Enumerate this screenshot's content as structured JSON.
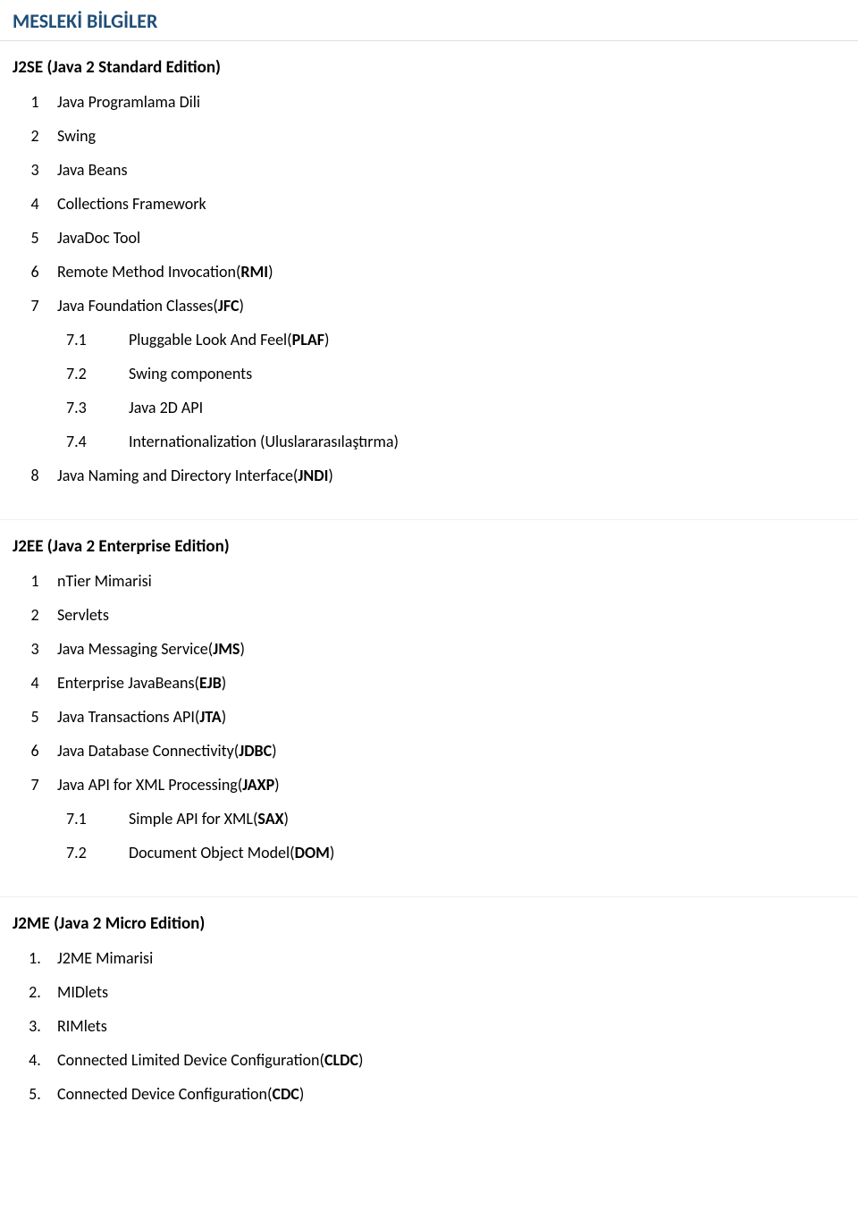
{
  "pageTitle": "MESLEKİ BİLGİLER",
  "sections": [
    {
      "title": "J2SE (Java 2 Standard Edition)",
      "dotted": false,
      "items": [
        {
          "num": "1",
          "text": "Java Programlama Dili"
        },
        {
          "num": "2",
          "text": "Swing"
        },
        {
          "num": "3",
          "text": "Java Beans"
        },
        {
          "num": "4",
          "text": "Collections Framework"
        },
        {
          "num": "5",
          "text": "JavaDoc Tool"
        },
        {
          "num": "6",
          "pre": "Remote Method Invocation(",
          "bold": "RMI",
          "post": ")"
        },
        {
          "num": "7",
          "pre": "Java Foundation Classes(",
          "bold": "JFC",
          "post": ")",
          "sub": [
            {
              "num": "7.1",
              "pre": "Pluggable Look And Feel(",
              "bold": "PLAF",
              "post": ")"
            },
            {
              "num": "7.2",
              "text": "Swing components"
            },
            {
              "num": "7.3",
              "text": "Java 2D API"
            },
            {
              "num": "7.4",
              "text": "Internationalization (Uluslararasılaştırma)"
            }
          ]
        },
        {
          "num": "8",
          "pre": "Java Naming and Directory Interface(",
          "bold": "JNDI",
          "post": ")"
        }
      ]
    },
    {
      "title": "J2EE (Java 2 Enterprise Edition)",
      "dotted": false,
      "items": [
        {
          "num": "1",
          "text": "nTier Mimarisi"
        },
        {
          "num": "2",
          "text": "Servlets"
        },
        {
          "num": "3",
          "pre": "Java Messaging Service(",
          "bold": "JMS",
          "post": ")"
        },
        {
          "num": "4",
          "pre": "Enterprise JavaBeans(",
          "bold": "EJB",
          "post": ")"
        },
        {
          "num": "5",
          "pre": "Java Transactions API(",
          "bold": "JTA",
          "post": ")"
        },
        {
          "num": "6",
          "pre": "Java Database Connectivity(",
          "bold": "JDBC",
          "post": ")"
        },
        {
          "num": "7",
          "pre": "Java API for XML Processing(",
          "bold": "JAXP",
          "post": ")",
          "sub": [
            {
              "num": "7.1",
              "pre": "Simple API for XML(",
              "bold": "SAX",
              "post": ")"
            },
            {
              "num": "7.2",
              "pre": "Document Object Model(",
              "bold": "DOM",
              "post": ")"
            }
          ]
        }
      ]
    },
    {
      "title": "J2ME (Java 2 Micro Edition)",
      "dotted": true,
      "items": [
        {
          "num": "1",
          "text": "J2ME Mimarisi"
        },
        {
          "num": "2",
          "text": "MIDlets"
        },
        {
          "num": "3",
          "text": "RIMlets"
        },
        {
          "num": "4",
          "pre": "Connected Limited Device Configuration(",
          "bold": "CLDC",
          "post": ")"
        },
        {
          "num": "5",
          "pre": "Connected Device Configuration(",
          "bold": "CDC",
          "post": ")"
        }
      ]
    }
  ]
}
